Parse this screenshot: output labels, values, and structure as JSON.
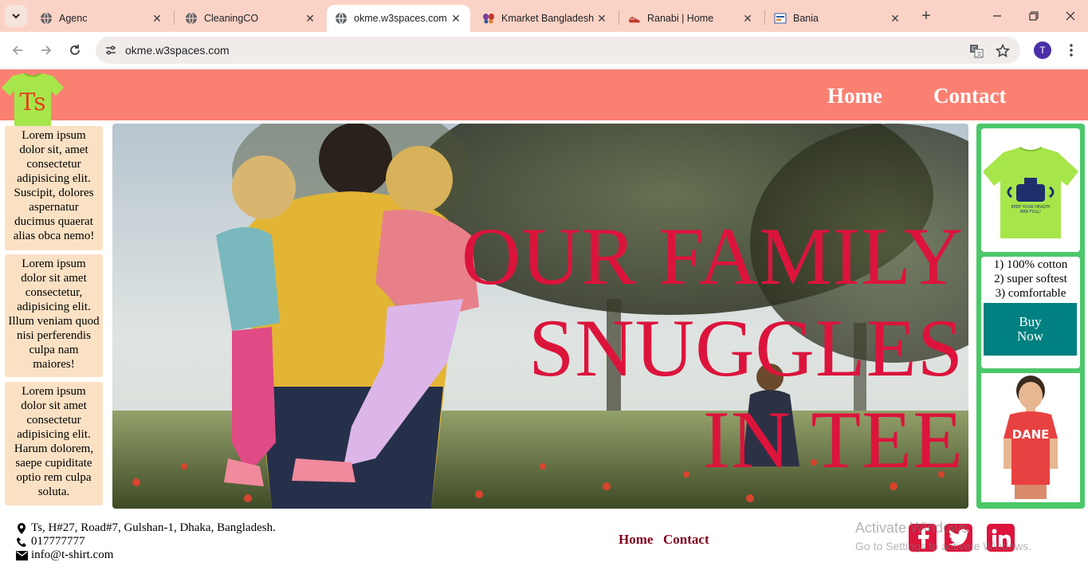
{
  "browser": {
    "tabs": [
      {
        "title": "Agenc",
        "active": false
      },
      {
        "title": "CleaningCO",
        "active": false
      },
      {
        "title": "okme.w3spaces.com",
        "active": true
      },
      {
        "title": "Kmarket Bangladesh",
        "active": false
      },
      {
        "title": "Ranabi | Home",
        "active": false
      },
      {
        "title": "Bania",
        "active": false
      }
    ],
    "url": "okme.w3spaces.com",
    "profile_initial": "T"
  },
  "site": {
    "logo_text": "Ts",
    "nav": [
      "Home",
      "Contact"
    ],
    "sidebar": [
      "Lorem ipsum dolor sit, amet consectetur adipisicing elit. Suscipit, dolores aspernatur ducimus quaerat alias obca nemo!",
      "Lorem ipsum dolor sit amet consectetur, adipisicing elit. Illum veniam quod nisi perferendis culpa nam maiores!",
      "Lorem ipsum dolor sit amet consectetur adipisicing elit. Harum dolorem, saepe cupiditate optio rem culpa soluta."
    ],
    "hero": {
      "line1": "OUR FAMILY",
      "line2": "SNUGGLES",
      "line3": "IN TEE"
    },
    "product": {
      "shirt_print_line1": "KEEP YOUR HEALTH",
      "shirt_print_line2": "BRR FULL!",
      "features": [
        "1) 100% cotton",
        "2) super softest",
        "3) comfortable"
      ],
      "buy_label": "Buy Now",
      "kid_shirt_text": "DANE"
    },
    "footer": {
      "address": "Ts, H#27, Road#7, Gulshan-1, Dhaka, Bangladesh.",
      "phone": "017777777",
      "email": "info@t-shirt.com",
      "nav": [
        "Home",
        "Contact"
      ]
    },
    "colors": {
      "header": "#fa8072",
      "accent": "#dc143c",
      "sidebar_bg": "#fbe1c4",
      "panel_green": "#4cc86a",
      "buy_button": "#008080"
    }
  },
  "os_watermark": {
    "line1": "Activate Windows",
    "line2": "Go to Settings to activate Windows."
  }
}
